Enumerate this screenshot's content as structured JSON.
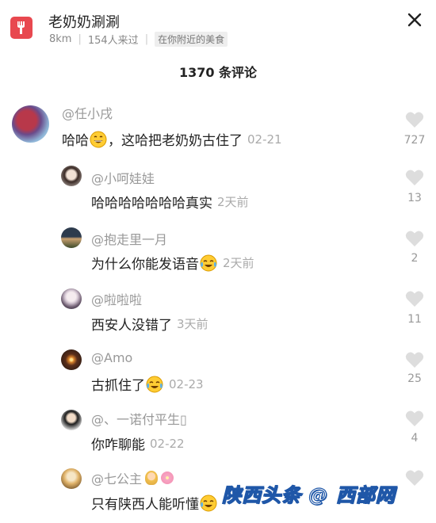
{
  "header": {
    "shop_name": "老奶奶涮涮",
    "distance": "8km",
    "visits": "154人来过",
    "badge": "在你附近的美食"
  },
  "comment_count": "1370 条评论",
  "comments": [
    {
      "username": "@任小戌",
      "text_before": "哈哈",
      "text_after": "，这哈把老奶奶古住了",
      "time": "02-21",
      "likes": "727"
    },
    {
      "username": "@小呵娃娃",
      "text": "哈哈哈哈哈哈哈真实",
      "time": "2天前",
      "likes": "13"
    },
    {
      "username": "@抱走里一月",
      "text": "为什么你能发语音",
      "time": "2天前",
      "likes": "2"
    },
    {
      "username": "@啦啦啦",
      "text": "西安人没错了",
      "time": "3天前",
      "likes": "11"
    },
    {
      "username": "@Amo",
      "text": "古抓住了",
      "time": "02-23",
      "likes": "25"
    },
    {
      "username": "@、一诺付平生▯",
      "text": "你咋聊能",
      "time": "02-22",
      "likes": "4"
    },
    {
      "username": "@七公主",
      "text": "只有陕西人能听懂",
      "time": "",
      "likes": ""
    }
  ],
  "watermark": "陕西头条 @ 西部网",
  "colors": {
    "icon_red": "#e8484f",
    "like_gray": "#dddddd",
    "watermark_blue": "#1f57a8"
  }
}
